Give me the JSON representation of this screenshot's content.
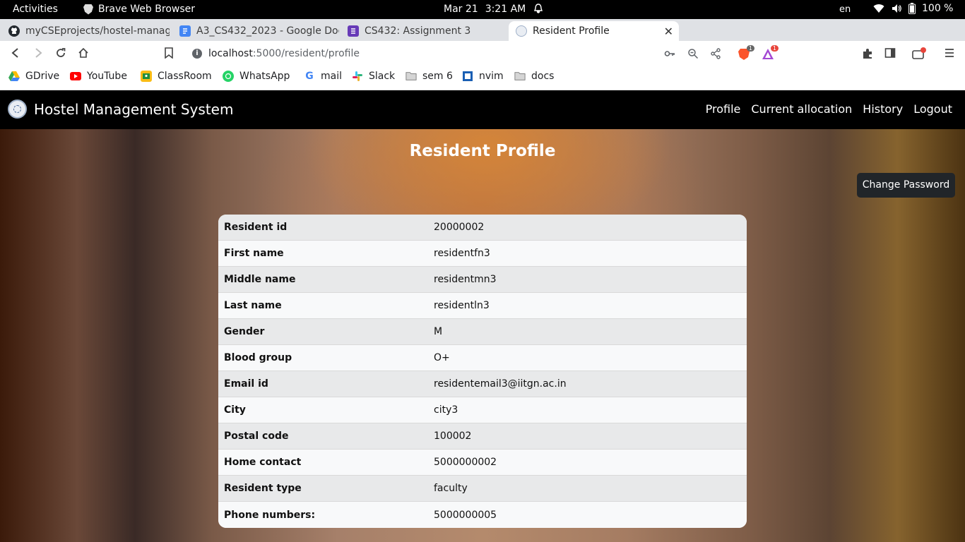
{
  "os_bar": {
    "activities": "Activities",
    "app_name": "Brave Web Browser",
    "date": "Mar 21",
    "time": "3:21 AM",
    "language": "en",
    "battery": "100 %"
  },
  "tabs": [
    {
      "title": "myCSEprojects/hostel-manag",
      "icon": "github-icon"
    },
    {
      "title": "A3_CS432_2023 - Google Docs",
      "icon": "google-docs-icon"
    },
    {
      "title": "CS432: Assignment 3",
      "icon": "google-forms-icon"
    },
    {
      "title": "Resident Profile",
      "icon": "site-logo-icon",
      "active": true
    }
  ],
  "address_bar": {
    "host": "localhost",
    "path": ":5000/resident/profile"
  },
  "extensions": {
    "brave_shields_count": "1",
    "rewards_count": "1"
  },
  "bookmarks": [
    {
      "label": "GDrive",
      "icon": "google-drive-icon"
    },
    {
      "label": "YouTube",
      "icon": "youtube-icon"
    },
    {
      "label": "ClassRoom",
      "icon": "classroom-icon"
    },
    {
      "label": "WhatsApp",
      "icon": "whatsapp-icon"
    },
    {
      "label": "mail",
      "icon": "google-icon"
    },
    {
      "label": "Slack",
      "icon": "slack-icon"
    },
    {
      "label": "sem 6",
      "icon": "folder-icon"
    },
    {
      "label": "nvim",
      "icon": "nvim-icon"
    },
    {
      "label": "docs",
      "icon": "folder-icon"
    }
  ],
  "site": {
    "brand": "Hostel Management System",
    "nav": [
      "Profile",
      "Current allocation",
      "History",
      "Logout"
    ],
    "title": "Resident Profile",
    "change_password": "Change Password"
  },
  "profile": [
    {
      "label": "Resident id",
      "value": "20000002"
    },
    {
      "label": "First name",
      "value": "residentfn3"
    },
    {
      "label": "Middle name",
      "value": "residentmn3"
    },
    {
      "label": "Last name",
      "value": "residentln3"
    },
    {
      "label": "Gender",
      "value": "M"
    },
    {
      "label": "Blood group",
      "value": "O+"
    },
    {
      "label": "Email id",
      "value": "residentemail3@iitgn.ac.in"
    },
    {
      "label": "City",
      "value": "city3"
    },
    {
      "label": "Postal code",
      "value": "100002"
    },
    {
      "label": "Home contact",
      "value": "5000000002"
    },
    {
      "label": "Resident type",
      "value": "faculty"
    },
    {
      "label": "Phone numbers:",
      "value": "5000000005"
    }
  ],
  "colors": {
    "navbar": "#000000",
    "button": "#212529",
    "row_odd": "#e8e9ea",
    "row_even": "#f8f9fa"
  }
}
